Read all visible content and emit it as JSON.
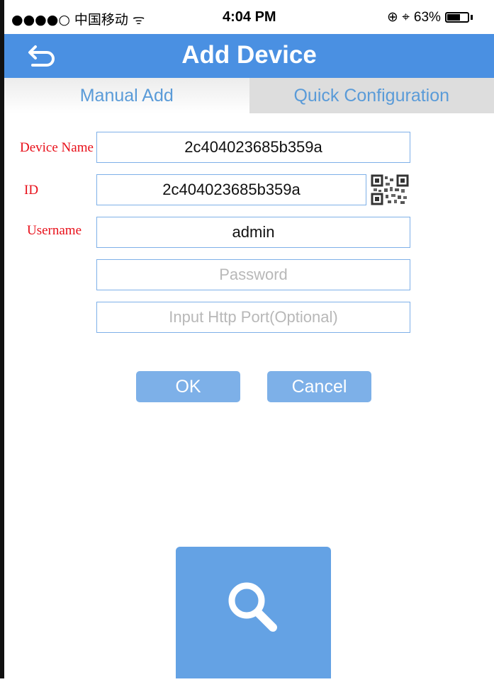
{
  "status_bar": {
    "carrier": "●●●●○ 中国移动 ᯤ",
    "time": "4:04 PM",
    "alarm": "⊕ ⌖",
    "battery": "63%",
    "battery_level": 0.63
  },
  "header": {
    "title": "Add Device",
    "back_icon": "back-arrow-icon"
  },
  "tabs": [
    {
      "label": "Manual Add",
      "active": true
    },
    {
      "label": "Quick Configuration",
      "active": false
    }
  ],
  "form": {
    "device_name_label": "Device Name",
    "device_name_value": "2c404023685b359a",
    "id_label": "ID",
    "id_value": "2c404023685b359a",
    "username_label": "Username",
    "username_value": "admin",
    "password_placeholder": "Password",
    "http_port_placeholder": "Input Http Port(Optional)",
    "qr_icon": "qr-code-icon"
  },
  "buttons": {
    "ok": "OK",
    "cancel": "Cancel",
    "search_icon": "search-icon"
  },
  "colors": {
    "accent": "#4a90e2",
    "tab_text": "#5a9bd8",
    "label_red": "#e8101a",
    "button": "#7db0e8"
  }
}
